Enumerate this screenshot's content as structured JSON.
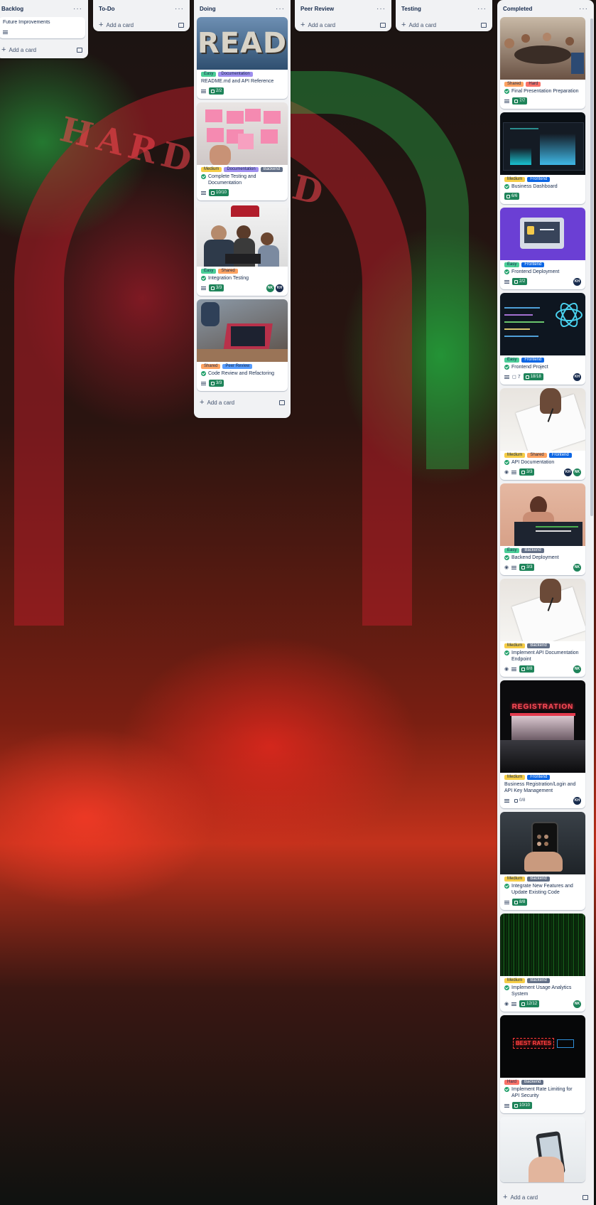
{
  "labels": {
    "easy": {
      "text": "Easy",
      "color": "#4bce97"
    },
    "hard": {
      "text": "Hard",
      "color": "#f87168"
    },
    "medium": {
      "text": "Medium",
      "color": "#f5cd47"
    },
    "shared": {
      "text": "Shared",
      "color": "#fea362"
    },
    "documentation": {
      "text": "Documentation",
      "color": "#9f8fef"
    },
    "backend": {
      "text": "Backend",
      "color": "#626f86"
    },
    "frontend": {
      "text": "Frontend",
      "color": "#0c66e4"
    },
    "peer_review": {
      "text": "Peer Review",
      "color": "#579dff"
    }
  },
  "lists": {
    "backlog": {
      "title": "Backlog",
      "add": "Add a card",
      "card1": {
        "title": "Future Improvements"
      }
    },
    "todo": {
      "title": "To-Do",
      "add": "Add a card"
    },
    "doing": {
      "title": "Doing",
      "add": "Add a card",
      "c1": {
        "title": "README.md and API Reference",
        "l1": "Easy",
        "l2": "Documentation",
        "check": "2/2"
      },
      "c2": {
        "title": "Complete Testing and Documentation",
        "l1": "Medium",
        "l2": "Documentation",
        "l3": "Backend",
        "check": "10/10"
      },
      "c3": {
        "title": "Integration Testing",
        "l1": "Easy",
        "l2": "Shared",
        "check": "3/3",
        "a1": "NK",
        "a2": "KH"
      },
      "c4": {
        "title": "Code Review and Refactoring",
        "l1": "Shared",
        "l2": "Peer Review",
        "check": "3/3"
      }
    },
    "peer_review": {
      "title": "Peer Review",
      "add": "Add a card"
    },
    "testing": {
      "title": "Testing",
      "add": "Add a card"
    },
    "completed": {
      "title": "Completed",
      "add": "Add a card",
      "c1": {
        "title": "Final Presentation Preparation",
        "l1": "Shared",
        "l2": "Hard",
        "check": "7/7"
      },
      "c2": {
        "title": "Business Dashboard",
        "l1": "Medium",
        "l2": "Frontend",
        "check": "6/6"
      },
      "c3": {
        "title": "Frontend Deployment",
        "l1": "Easy",
        "l2": "Frontend",
        "check": "2/2",
        "a1": "KH"
      },
      "c4": {
        "title": "Frontend Project",
        "l1": "Easy",
        "l2": "Frontend",
        "comments": "7",
        "check": "18/18",
        "a1": "KH"
      },
      "c5": {
        "title": "API Documentation",
        "l1": "Medium",
        "l2": "Shared",
        "l3": "Frontend",
        "check": "3/3",
        "a1": "KH",
        "a2": "NK"
      },
      "c6": {
        "title": "Backend Deployment",
        "l1": "Easy",
        "l2": "Backend",
        "check": "3/3",
        "a1": "NK"
      },
      "c7": {
        "title": "Implement API Documentation Endpoint",
        "l1": "Medium",
        "l2": "Backend",
        "check": "8/8",
        "a1": "NK"
      },
      "c8": {
        "title": "Business Registration/Login and API Key Management",
        "l1": "Medium",
        "l2": "Frontend",
        "check": "0/8",
        "a1": "KH"
      },
      "c9": {
        "title": "Integrate New Features and Update Existing Code",
        "l1": "Medium",
        "l2": "Backend",
        "check": "8/8"
      },
      "c10": {
        "title": "Implement Usage Analytics System",
        "l1": "Medium",
        "l2": "Backend",
        "check": "12/12",
        "a1": "NK"
      },
      "c11": {
        "title": "Implement Rate Limiting for API Security",
        "l1": "Hard",
        "l2": "Backend",
        "check": "10/10"
      }
    }
  },
  "covers": {
    "read": "READ",
    "registration": "REGISTRATION",
    "best_rates": "BEST RATES"
  }
}
